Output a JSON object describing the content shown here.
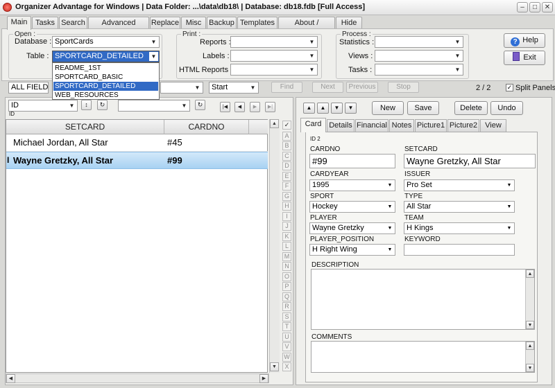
{
  "window": {
    "title": "Organizer Advantage for Windows | Data Folder: ...\\data\\db18\\ | Database: db18.fdb [Full Access]",
    "min_glyph": "–",
    "max_glyph": "□",
    "close_glyph": "✕"
  },
  "main_tabs": [
    "Main",
    "Tasks",
    "Search",
    "Advanced Search",
    "Replace",
    "Misc",
    "Backup",
    "Templates",
    "About / Upgrade",
    "Hide"
  ],
  "open_group": {
    "legend": "Open :",
    "database_label": "Database :",
    "database_value": "SportCards",
    "table_label": "Table :",
    "table_value": "SPORTCARD_DETAILED",
    "table_options": [
      "README_1ST",
      "SPORTCARD_BASIC",
      "SPORTCARD_DETAILED",
      "WEB_RESOURCES"
    ]
  },
  "print_group": {
    "legend": "Print :",
    "reports_label": "Reports :",
    "labels_label": "Labels :",
    "html_reports_label": "HTML Reports :"
  },
  "process_group": {
    "legend": "Process :",
    "statistics_label": "Statistics :",
    "views_label": "Views :",
    "tasks_label": "Tasks :"
  },
  "help_label": "Help",
  "exit_label": "Exit",
  "find_bar": {
    "field_value": "ALL FIELDS",
    "mode_value": "Start",
    "find": "Find",
    "next": "Next",
    "previous": "Previous",
    "stop": "Stop",
    "record_pos": "2 / 2",
    "split_panels": "Split Panels"
  },
  "sort_bar": {
    "field_value": "ID",
    "field_caption": "ID",
    "sort_glyph": "↕",
    "refresh_glyph": "↻",
    "first": "|◀",
    "prev": "◀",
    "next": "▶",
    "last": "▶|"
  },
  "grid": {
    "columns": [
      "SETCARD",
      "CARDNO"
    ],
    "rows": [
      {
        "setcard": "Michael Jordan, All Star",
        "cardno": "#45"
      },
      {
        "setcard": "Wayne Gretzky, All Star",
        "cardno": "#99"
      }
    ],
    "row_cursor": "I",
    "check_glyph": "✓",
    "alpha": [
      "A",
      "B",
      "C",
      "D",
      "E",
      "F",
      "G",
      "H",
      "I",
      "J",
      "K",
      "L",
      "M",
      "N",
      "O",
      "P",
      "Q",
      "R",
      "S",
      "T",
      "U",
      "V",
      "W",
      "X"
    ]
  },
  "record_nav": {
    "first": "▲",
    "prev": "▲",
    "next": "▼",
    "last": "▼"
  },
  "actions": {
    "new": "New",
    "save": "Save",
    "delete": "Delete",
    "undo": "Undo"
  },
  "detail_tabs": [
    "Card",
    "Details",
    "Financial",
    "Notes",
    "Picture1",
    "Picture2",
    "View"
  ],
  "card": {
    "id_caption": "ID 2",
    "cardno_label": "CARDNO",
    "cardno": "#99",
    "setcard_label": "SETCARD",
    "setcard": "Wayne Gretzky, All Star",
    "cardyear_label": "CARDYEAR",
    "cardyear": "1995",
    "issuer_label": "ISSUER",
    "issuer": "Pro Set",
    "sport_label": "SPORT",
    "sport": "Hockey",
    "type_label": "TYPE",
    "type": "All Star",
    "player_label": "PLAYER",
    "player": "Wayne Gretzky",
    "team_label": "TEAM",
    "team": "H Kings",
    "position_label": "PLAYER_POSITION",
    "position": "H Right Wing",
    "keyword_label": "KEYWORD",
    "keyword": "",
    "description_label": "DESCRIPTION",
    "comments_label": "COMMENTS"
  }
}
